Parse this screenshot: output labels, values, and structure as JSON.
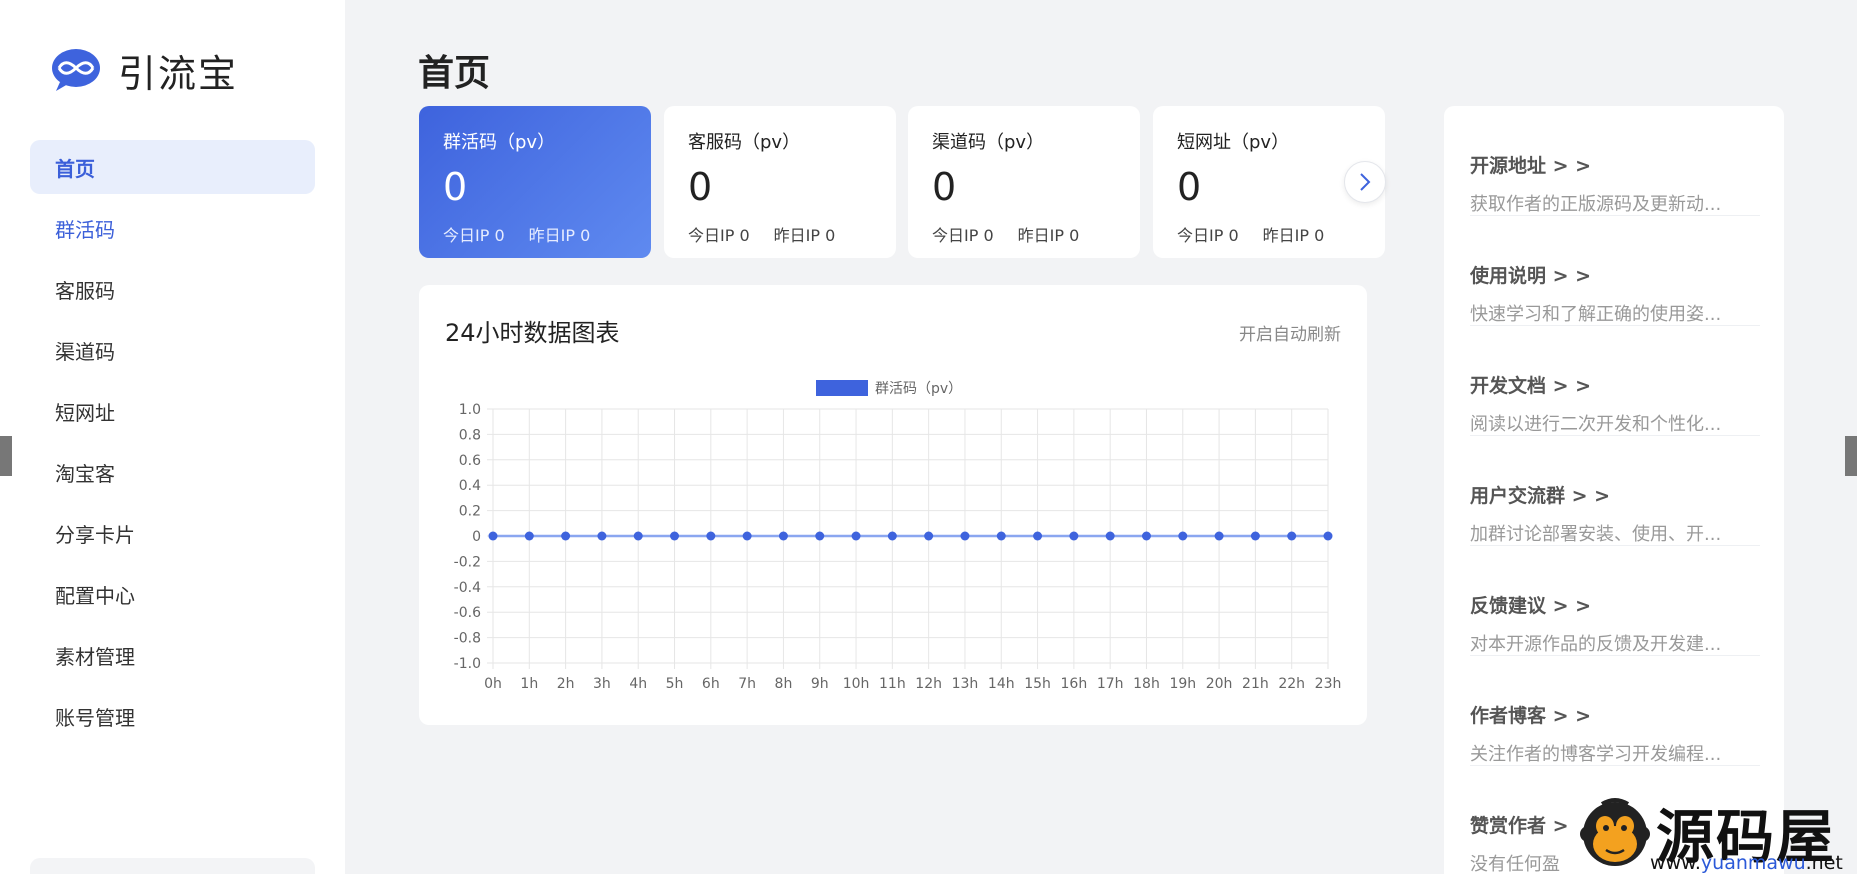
{
  "brand": {
    "name": "引流宝"
  },
  "sidebar": {
    "items": [
      {
        "label": "首页"
      },
      {
        "label": "群活码"
      },
      {
        "label": "客服码"
      },
      {
        "label": "渠道码"
      },
      {
        "label": "短网址"
      },
      {
        "label": "淘宝客"
      },
      {
        "label": "分享卡片"
      },
      {
        "label": "配置中心"
      },
      {
        "label": "素材管理"
      },
      {
        "label": "账号管理"
      }
    ]
  },
  "page": {
    "title": "首页"
  },
  "stats": [
    {
      "label": "群活码（pv）",
      "value": "0",
      "today": "今日IP 0",
      "yesterday": "昨日IP 0"
    },
    {
      "label": "客服码（pv）",
      "value": "0",
      "today": "今日IP 0",
      "yesterday": "昨日IP 0"
    },
    {
      "label": "渠道码（pv）",
      "value": "0",
      "today": "今日IP 0",
      "yesterday": "昨日IP 0"
    },
    {
      "label": "短网址（pv）",
      "value": "0",
      "today": "今日IP 0",
      "yesterday": "昨日IP 0"
    }
  ],
  "chart_panel": {
    "title": "24小时数据图表",
    "refresh_label": "开启自动刷新"
  },
  "chart_data": {
    "type": "line",
    "x": [
      "0h",
      "1h",
      "2h",
      "3h",
      "4h",
      "5h",
      "6h",
      "7h",
      "8h",
      "9h",
      "10h",
      "11h",
      "12h",
      "13h",
      "14h",
      "15h",
      "16h",
      "17h",
      "18h",
      "19h",
      "20h",
      "21h",
      "22h",
      "23h"
    ],
    "series": [
      {
        "name": "群活码（pv）",
        "values": [
          0,
          0,
          0,
          0,
          0,
          0,
          0,
          0,
          0,
          0,
          0,
          0,
          0,
          0,
          0,
          0,
          0,
          0,
          0,
          0,
          0,
          0,
          0,
          0
        ],
        "color": "#3e63dd"
      }
    ],
    "yticks": [
      "1.0",
      "0.8",
      "0.6",
      "0.4",
      "0.2",
      "0",
      "-0.2",
      "-0.4",
      "-0.6",
      "-0.8",
      "-1.0"
    ],
    "ylim": [
      -1.0,
      1.0
    ],
    "grid": true,
    "legend": "top-center"
  },
  "links": [
    {
      "title": "开源地址 > >",
      "desc": "获取作者的正版源码及更新动..."
    },
    {
      "title": "使用说明 > >",
      "desc": "快速学习和了解正确的使用姿..."
    },
    {
      "title": "开发文档 > >",
      "desc": "阅读以进行二次开发和个性化..."
    },
    {
      "title": "用户交流群 > >",
      "desc": "加群讨论部署安装、使用、开..."
    },
    {
      "title": "反馈建议 > >",
      "desc": "对本开源作品的反馈及开发建..."
    },
    {
      "title": "作者博客 > >",
      "desc": "关注作者的博客学习开发编程..."
    },
    {
      "title": "赞赏作者 >",
      "desc": "没有任何盈"
    }
  ],
  "watermark": {
    "title": "源码屋",
    "url_prefix": "www.",
    "url_mid": "yuanmawu",
    "url_suffix": ".net"
  },
  "colors": {
    "accent": "#3e63dd",
    "sidebar_active_bg": "#e8eefc"
  }
}
